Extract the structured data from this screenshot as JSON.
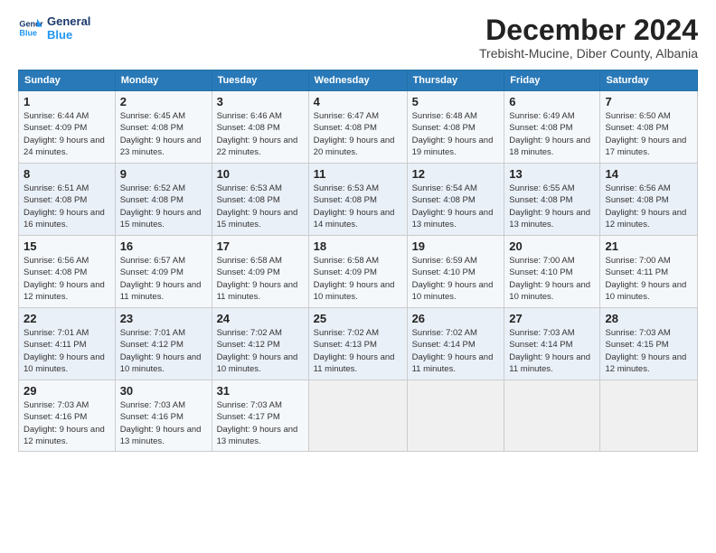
{
  "header": {
    "logo_line1": "General",
    "logo_line2": "Blue",
    "month": "December 2024",
    "location": "Trebisht-Mucine, Diber County, Albania"
  },
  "weekdays": [
    "Sunday",
    "Monday",
    "Tuesday",
    "Wednesday",
    "Thursday",
    "Friday",
    "Saturday"
  ],
  "weeks": [
    [
      {
        "day": "1",
        "sunrise": "6:44 AM",
        "sunset": "4:09 PM",
        "daylight": "9 hours and 24 minutes."
      },
      {
        "day": "2",
        "sunrise": "6:45 AM",
        "sunset": "4:08 PM",
        "daylight": "9 hours and 23 minutes."
      },
      {
        "day": "3",
        "sunrise": "6:46 AM",
        "sunset": "4:08 PM",
        "daylight": "9 hours and 22 minutes."
      },
      {
        "day": "4",
        "sunrise": "6:47 AM",
        "sunset": "4:08 PM",
        "daylight": "9 hours and 20 minutes."
      },
      {
        "day": "5",
        "sunrise": "6:48 AM",
        "sunset": "4:08 PM",
        "daylight": "9 hours and 19 minutes."
      },
      {
        "day": "6",
        "sunrise": "6:49 AM",
        "sunset": "4:08 PM",
        "daylight": "9 hours and 18 minutes."
      },
      {
        "day": "7",
        "sunrise": "6:50 AM",
        "sunset": "4:08 PM",
        "daylight": "9 hours and 17 minutes."
      }
    ],
    [
      {
        "day": "8",
        "sunrise": "6:51 AM",
        "sunset": "4:08 PM",
        "daylight": "9 hours and 16 minutes."
      },
      {
        "day": "9",
        "sunrise": "6:52 AM",
        "sunset": "4:08 PM",
        "daylight": "9 hours and 15 minutes."
      },
      {
        "day": "10",
        "sunrise": "6:53 AM",
        "sunset": "4:08 PM",
        "daylight": "9 hours and 15 minutes."
      },
      {
        "day": "11",
        "sunrise": "6:53 AM",
        "sunset": "4:08 PM",
        "daylight": "9 hours and 14 minutes."
      },
      {
        "day": "12",
        "sunrise": "6:54 AM",
        "sunset": "4:08 PM",
        "daylight": "9 hours and 13 minutes."
      },
      {
        "day": "13",
        "sunrise": "6:55 AM",
        "sunset": "4:08 PM",
        "daylight": "9 hours and 13 minutes."
      },
      {
        "day": "14",
        "sunrise": "6:56 AM",
        "sunset": "4:08 PM",
        "daylight": "9 hours and 12 minutes."
      }
    ],
    [
      {
        "day": "15",
        "sunrise": "6:56 AM",
        "sunset": "4:08 PM",
        "daylight": "9 hours and 12 minutes."
      },
      {
        "day": "16",
        "sunrise": "6:57 AM",
        "sunset": "4:09 PM",
        "daylight": "9 hours and 11 minutes."
      },
      {
        "day": "17",
        "sunrise": "6:58 AM",
        "sunset": "4:09 PM",
        "daylight": "9 hours and 11 minutes."
      },
      {
        "day": "18",
        "sunrise": "6:58 AM",
        "sunset": "4:09 PM",
        "daylight": "9 hours and 10 minutes."
      },
      {
        "day": "19",
        "sunrise": "6:59 AM",
        "sunset": "4:10 PM",
        "daylight": "9 hours and 10 minutes."
      },
      {
        "day": "20",
        "sunrise": "7:00 AM",
        "sunset": "4:10 PM",
        "daylight": "9 hours and 10 minutes."
      },
      {
        "day": "21",
        "sunrise": "7:00 AM",
        "sunset": "4:11 PM",
        "daylight": "9 hours and 10 minutes."
      }
    ],
    [
      {
        "day": "22",
        "sunrise": "7:01 AM",
        "sunset": "4:11 PM",
        "daylight": "9 hours and 10 minutes."
      },
      {
        "day": "23",
        "sunrise": "7:01 AM",
        "sunset": "4:12 PM",
        "daylight": "9 hours and 10 minutes."
      },
      {
        "day": "24",
        "sunrise": "7:02 AM",
        "sunset": "4:12 PM",
        "daylight": "9 hours and 10 minutes."
      },
      {
        "day": "25",
        "sunrise": "7:02 AM",
        "sunset": "4:13 PM",
        "daylight": "9 hours and 11 minutes."
      },
      {
        "day": "26",
        "sunrise": "7:02 AM",
        "sunset": "4:14 PM",
        "daylight": "9 hours and 11 minutes."
      },
      {
        "day": "27",
        "sunrise": "7:03 AM",
        "sunset": "4:14 PM",
        "daylight": "9 hours and 11 minutes."
      },
      {
        "day": "28",
        "sunrise": "7:03 AM",
        "sunset": "4:15 PM",
        "daylight": "9 hours and 12 minutes."
      }
    ],
    [
      {
        "day": "29",
        "sunrise": "7:03 AM",
        "sunset": "4:16 PM",
        "daylight": "9 hours and 12 minutes."
      },
      {
        "day": "30",
        "sunrise": "7:03 AM",
        "sunset": "4:16 PM",
        "daylight": "9 hours and 13 minutes."
      },
      {
        "day": "31",
        "sunrise": "7:03 AM",
        "sunset": "4:17 PM",
        "daylight": "9 hours and 13 minutes."
      },
      null,
      null,
      null,
      null
    ]
  ]
}
